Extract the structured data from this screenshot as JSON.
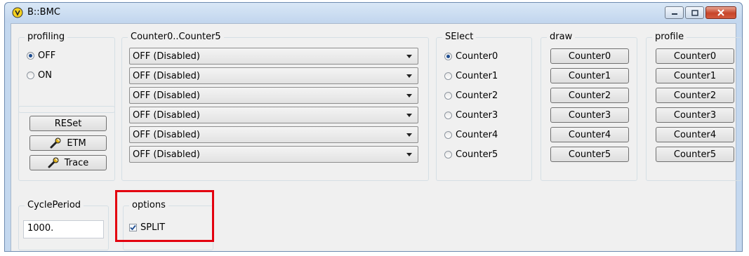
{
  "window": {
    "title": "B::BMC"
  },
  "profiling": {
    "legend": "profiling",
    "options": [
      {
        "label": "OFF",
        "selected": true
      },
      {
        "label": "ON",
        "selected": false
      }
    ],
    "buttons": {
      "reset": "RESet",
      "etm": "ETM",
      "trace": "Trace"
    }
  },
  "counters": {
    "legend": "Counter0..Counter5",
    "values": [
      "OFF (Disabled)",
      "OFF (Disabled)",
      "OFF (Disabled)",
      "OFF (Disabled)",
      "OFF (Disabled)",
      "OFF (Disabled)"
    ]
  },
  "select": {
    "legend": "SElect",
    "options": [
      "Counter0",
      "Counter1",
      "Counter2",
      "Counter3",
      "Counter4",
      "Counter5"
    ],
    "selected_index": 0
  },
  "draw": {
    "legend": "draw",
    "buttons": [
      "Counter0",
      "Counter1",
      "Counter2",
      "Counter3",
      "Counter4",
      "Counter5"
    ]
  },
  "profile": {
    "legend": "profile",
    "buttons": [
      "Counter0",
      "Counter1",
      "Counter2",
      "Counter3",
      "Counter4",
      "Counter5"
    ]
  },
  "cycleperiod": {
    "legend": "CyclePeriod",
    "value": "1000."
  },
  "options": {
    "legend": "options",
    "split_label": "SPLIT",
    "split_checked": true
  },
  "colors": {
    "highlight": "#e3000f",
    "window_frame": "#c4d8ef",
    "close_button": "#c7452a"
  }
}
